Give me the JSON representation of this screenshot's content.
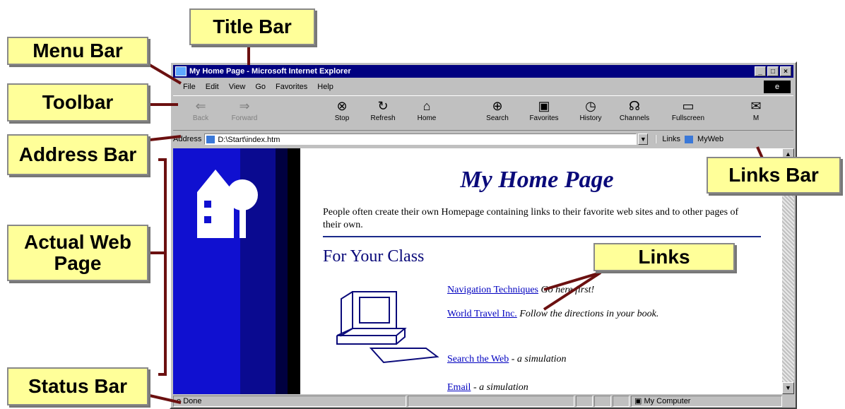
{
  "callouts": {
    "title_bar": "Title Bar",
    "menu_bar": "Menu Bar",
    "toolbar": "Toolbar",
    "address_bar": "Address Bar",
    "actual_web_page": "Actual Web Page",
    "status_bar": "Status Bar",
    "links_bar": "Links Bar",
    "links": "Links"
  },
  "window": {
    "title": "My Home Page - Microsoft Internet Explorer",
    "title_buttons": [
      "_",
      "□",
      "×"
    ],
    "menu": [
      "File",
      "Edit",
      "View",
      "Go",
      "Favorites",
      "Help"
    ],
    "toolbar": [
      {
        "label": "Back",
        "icon": "back-arrow-icon",
        "glyph": "⇐",
        "enabled": false
      },
      {
        "label": "Forward",
        "icon": "forward-arrow-icon",
        "glyph": "⇒",
        "enabled": false
      },
      {
        "label": "Stop",
        "icon": "stop-icon",
        "glyph": "⊗",
        "enabled": true
      },
      {
        "label": "Refresh",
        "icon": "refresh-icon",
        "glyph": "↻",
        "enabled": true
      },
      {
        "label": "Home",
        "icon": "home-icon",
        "glyph": "⌂",
        "enabled": true
      },
      {
        "label": "Search",
        "icon": "search-icon",
        "glyph": "⊕",
        "enabled": true
      },
      {
        "label": "Favorites",
        "icon": "favorites-icon",
        "glyph": "▣",
        "enabled": true
      },
      {
        "label": "History",
        "icon": "history-icon",
        "glyph": "◷",
        "enabled": true
      },
      {
        "label": "Channels",
        "icon": "channels-icon",
        "glyph": "☊",
        "enabled": true
      },
      {
        "label": "Fullscreen",
        "icon": "fullscreen-icon",
        "glyph": "▭",
        "enabled": true
      },
      {
        "label": "M",
        "icon": "mail-icon",
        "glyph": "✉",
        "enabled": true
      }
    ],
    "address": {
      "label": "Address",
      "value": "D:\\Start\\index.htm"
    },
    "links": {
      "label": "Links",
      "item": "MyWeb"
    },
    "page": {
      "heading": "My Home Page",
      "intro": "People often create their own Homepage containing links to their favorite web sites and to other pages of their own.",
      "section": "For Your Class",
      "items": [
        {
          "link": "Navigation Techniques",
          "desc": " Go here first!"
        },
        {
          "link": "World Travel Inc.",
          "desc": " Follow the directions in your book."
        },
        {
          "link": "Search the Web",
          "desc": " - a simulation"
        },
        {
          "link": "Email",
          "desc": " - a simulation"
        }
      ]
    },
    "status": {
      "text": "Done",
      "zone": "My Computer"
    }
  }
}
